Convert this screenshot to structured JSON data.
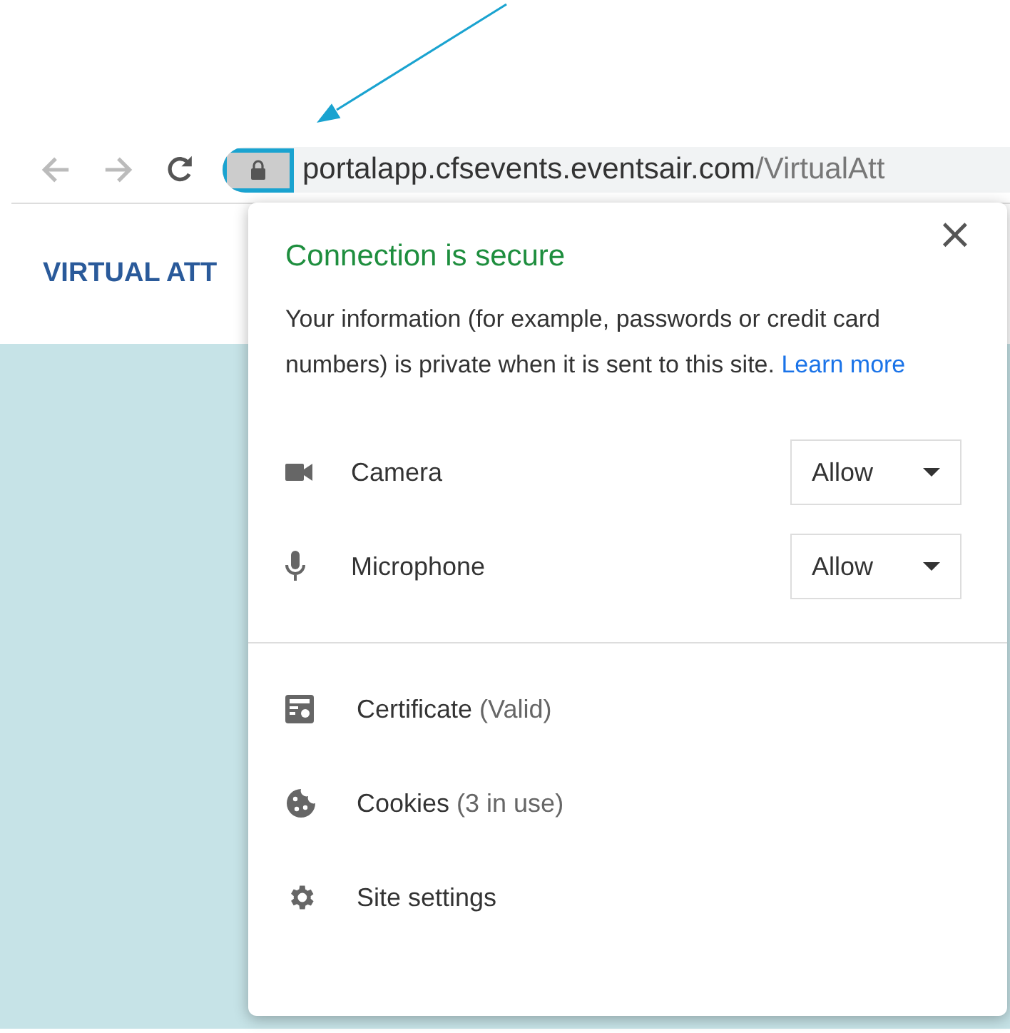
{
  "toolbar": {
    "url_host": "portalapp.cfsevents.eventsair.com",
    "url_path": "/VirtualAtt",
    "lock_highlighted": true
  },
  "page": {
    "header_title": "VIRTUAL ATT"
  },
  "popup": {
    "close": "×",
    "title": "Connection is secure",
    "description": "Your information (for example, passwords or credit card numbers) is private when it is sent to this site.",
    "link": "Learn more",
    "permissions": [
      {
        "kind": "camera",
        "label": "Camera",
        "value": "Allow"
      },
      {
        "kind": "microphone",
        "label": "Microphone",
        "value": "Allow"
      }
    ],
    "items": [
      {
        "kind": "certificate",
        "label": "Certificate",
        "detail": "(Valid)"
      },
      {
        "kind": "cookies",
        "label": "Cookies",
        "detail": "(3 in use)"
      },
      {
        "kind": "settings",
        "label": "Site settings"
      }
    ]
  }
}
